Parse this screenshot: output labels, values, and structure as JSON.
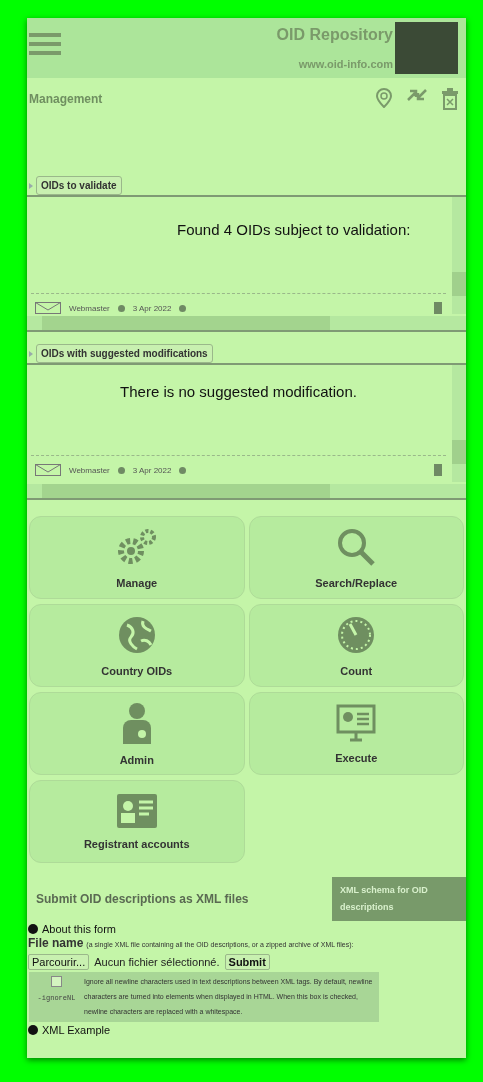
{
  "header": {
    "title": "OID Repository",
    "url": "www.oid-info.com"
  },
  "page_title": "Management",
  "sections": [
    {
      "legend": "OIDs to validate",
      "message": "Found 4 OIDs subject to validation:",
      "author": "Webmaster",
      "date": "3 Apr 2022"
    },
    {
      "legend": "OIDs with suggested modifications",
      "message": "There is no suggested modification.",
      "author": "Webmaster",
      "date": "3 Apr 2022"
    }
  ],
  "tiles": [
    {
      "kind": "gears",
      "label": "Manage"
    },
    {
      "kind": "search",
      "label": "Search/Replace"
    },
    {
      "kind": "globe",
      "label": "Country OIDs"
    },
    {
      "kind": "gauge",
      "label": "Count"
    },
    {
      "kind": "person",
      "label": "Admin"
    },
    {
      "kind": "screen",
      "label": "Execute"
    },
    {
      "kind": "card",
      "label": "Registrant accounts"
    }
  ],
  "submit": {
    "title": "Submit OID descriptions as XML files",
    "schema_button": "XML schema for OID descriptions",
    "about": "About this form",
    "file_label": "File name",
    "file_hint": "(a single XML file containing all the OID descriptions, or a zipped archive of XML files):",
    "browse_button": "Parcourir...",
    "file_status": "Aucun fichier sélectionné.",
    "submit_button": "Submit",
    "option": {
      "checked": false,
      "flag": "-ignoreNL",
      "description": "Ignore all newline characters used in text descriptions between XML tags. By default, newline characters are turned into elements when displayed in HTML. When this box is checked, newline characters are replaced with a whitespace."
    },
    "example": "XML Example"
  }
}
